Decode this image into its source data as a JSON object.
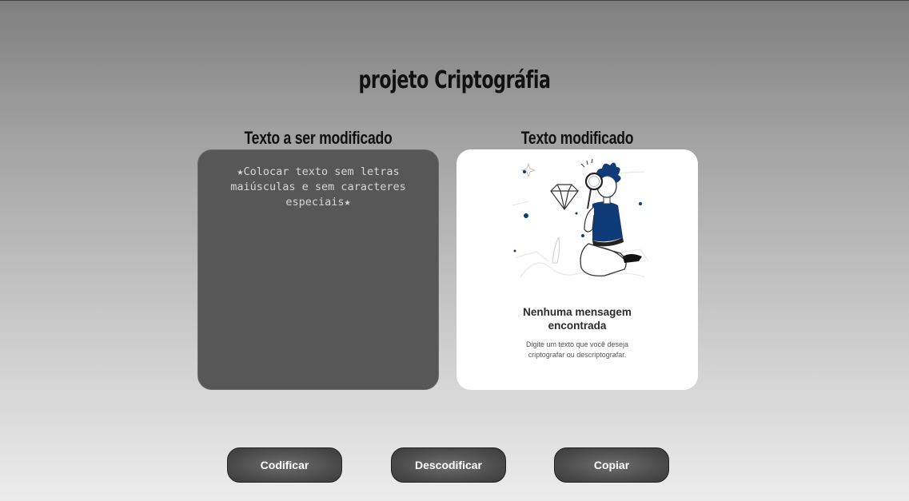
{
  "page": {
    "title": "projeto Criptográfia"
  },
  "input_panel": {
    "heading": "Texto a ser modificado",
    "value": "",
    "placeholder": "★Colocar texto sem letras maiúsculas e sem caracteres especiais★",
    "background_color": "#575757"
  },
  "output_panel": {
    "heading": "Texto modificado",
    "illustration_icon": "person-with-magnifying-glass-illustration",
    "empty_title_line1": "Nenhuma mensagem",
    "empty_title_line2": "encontrada",
    "empty_desc_line1": "Digite um texto que você deseja",
    "empty_desc_line2": "criptografar ou descriptografar.",
    "accent_color": "#0f3c78"
  },
  "buttons": {
    "encode_label": "Codificar",
    "decode_label": "Descodificar",
    "copy_label": "Copiar"
  }
}
